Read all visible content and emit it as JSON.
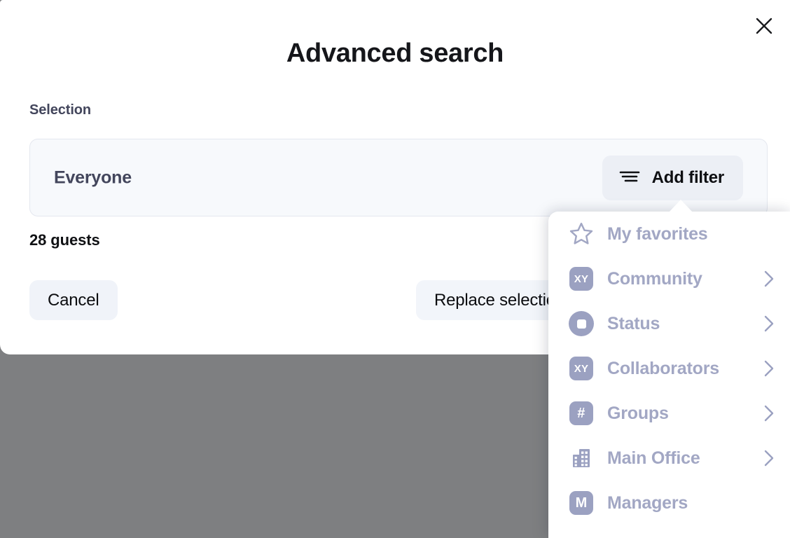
{
  "modal": {
    "title": "Advanced search",
    "close_icon": "close-icon",
    "section_label": "Selection",
    "selection_value": "Everyone",
    "add_filter": {
      "label": "Add filter",
      "icon": "filter-icon"
    },
    "guests_count": "28 guests",
    "cancel_label": "Cancel",
    "replace_label": "Replace selection"
  },
  "dropdown": {
    "items": [
      {
        "label": "My favorites",
        "icon": "star-outline-icon",
        "icon_kind": "star",
        "badge_text": "",
        "has_chevron": false
      },
      {
        "label": "Community",
        "icon": "xy-badge-icon",
        "icon_kind": "badge",
        "badge_text": "XY",
        "has_chevron": true
      },
      {
        "label": "Status",
        "icon": "status-circle-icon",
        "icon_kind": "status",
        "badge_text": "",
        "has_chevron": true
      },
      {
        "label": "Collaborators",
        "icon": "xy-badge-icon",
        "icon_kind": "badge",
        "badge_text": "XY",
        "has_chevron": true
      },
      {
        "label": "Groups",
        "icon": "hash-badge-icon",
        "icon_kind": "badge",
        "badge_text": "#",
        "has_chevron": true
      },
      {
        "label": "Main Office",
        "icon": "building-icon",
        "icon_kind": "building",
        "badge_text": "",
        "has_chevron": true
      },
      {
        "label": "Managers",
        "icon": "m-badge-icon",
        "icon_kind": "badge",
        "badge_text": "M",
        "has_chevron": false
      }
    ]
  },
  "colors": {
    "overlay": "#7e7f81",
    "modal_bg": "#ffffff",
    "title_text": "#15161a",
    "label_text": "#43465c",
    "muted_purple": "#a2a7c4",
    "badge_bg": "#9ba1c1",
    "selection_bg": "#f7f9fc",
    "button_bg": "#eceff5"
  }
}
